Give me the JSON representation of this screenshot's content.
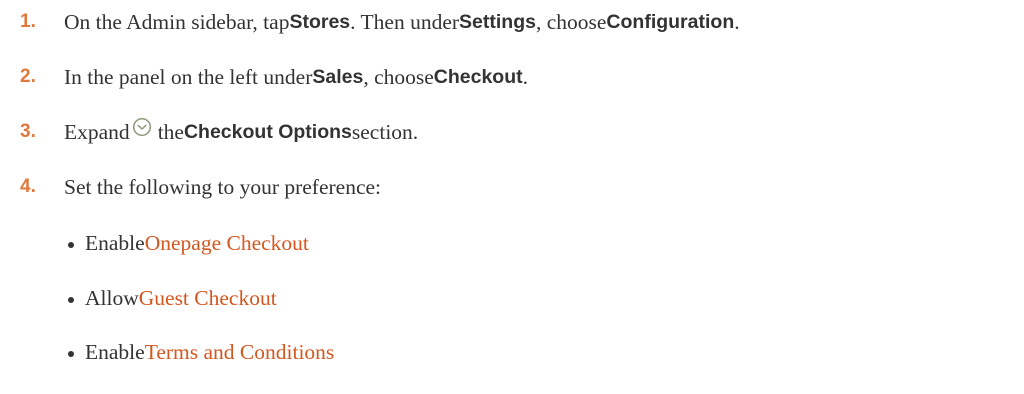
{
  "steps": [
    {
      "num": "1.",
      "t1": "On the Admin sidebar, tap ",
      "b1": "Stores",
      "t2": ". Then under ",
      "b2": "Settings",
      "t3": ", choose ",
      "b3": "Configuration",
      "t4": "."
    },
    {
      "num": "2.",
      "t1": "In the panel on the left under ",
      "b1": "Sales",
      "t2": ", choose ",
      "b2": "Checkout",
      "t3": "."
    },
    {
      "num": "3.",
      "t1": "Expand ",
      "icon": "expand-circle-chevron-icon",
      "t2": " the ",
      "b1": "Checkout Options",
      "t3": " section."
    },
    {
      "num": "4.",
      "t1": "Set the following to your preference:"
    }
  ],
  "bullets": [
    {
      "prefix": "Enable ",
      "link": "Onepage Checkout"
    },
    {
      "prefix": "Allow ",
      "link": "Guest Checkout"
    },
    {
      "prefix": "Enable ",
      "link": "Terms and Conditions"
    }
  ],
  "colors": {
    "step_number": "#e0793b",
    "link": "#d4571f",
    "text": "#333333",
    "icon": "#8a9a7a"
  }
}
